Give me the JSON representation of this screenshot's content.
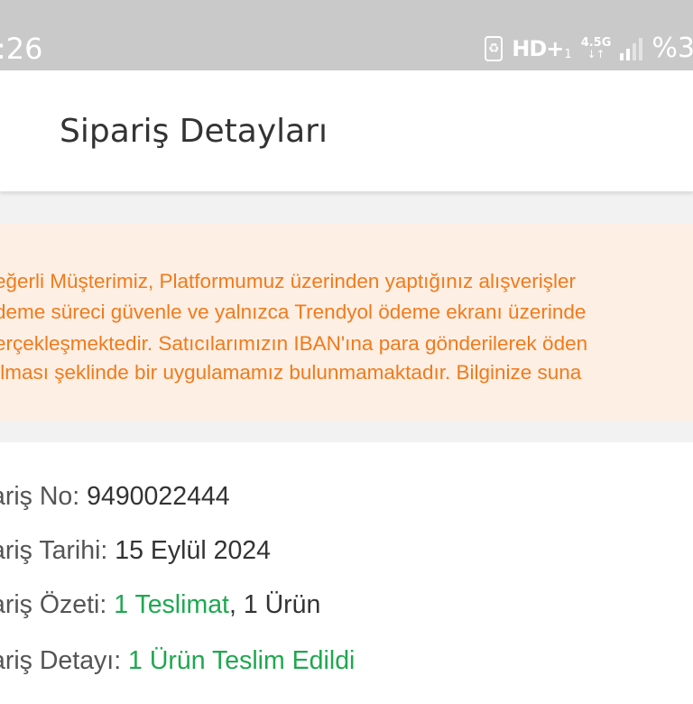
{
  "status_bar": {
    "time": ":26",
    "battery_saver_icon": "battery-saver-icon",
    "hd_label": "HD+",
    "hd_sub": "1",
    "network_type": "4.5G",
    "network_arrows": "↓↑",
    "signal_icon": "signal-icon",
    "battery_percent": "%3"
  },
  "header": {
    "title": "Sipariş Detayları"
  },
  "notice": {
    "lines": [
      "eğerli Müşterimiz, Platformumuz üzerinden yaptığınız alışverişler",
      "deme süreci güvenle ve yalnızca Trendyol ödeme ekranı üzerinde",
      "erçekleşmektedir. Satıcılarımızın IBAN'ına para gönderilerek öden",
      "ılması şeklinde bir uygulamamız bulunmamaktadır. Bilginize suna"
    ]
  },
  "order": {
    "no_label": "ariş No: ",
    "no_value": "9490022444",
    "date_label": "ariş Tarihi: ",
    "date_value": "15 Eylül 2024",
    "summary_label": "ariş Özeti: ",
    "summary_deliveries": "1 Teslimat",
    "summary_products": ", 1 Ürün",
    "detail_label": "ariş Detayı: ",
    "detail_value": "1 Ürün Teslim Edildi"
  },
  "colors": {
    "accent_orange": "#f27a1a",
    "notice_bg": "#fdefe4",
    "success_green": "#1ea84f",
    "status_bar_bg": "#c9c9c9"
  }
}
